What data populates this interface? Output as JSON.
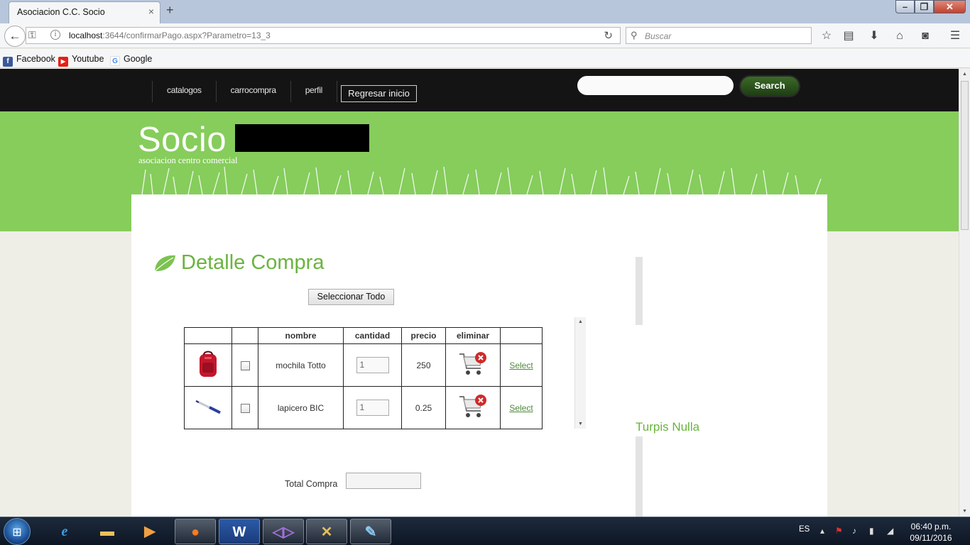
{
  "browser": {
    "tab_title": "Asociacion C.C. Socio",
    "tab_close": "×",
    "new_tab": "+",
    "url_host": "localhost",
    "url_rest": ":3644/confirmarPago.aspx?Parametro=13_3",
    "search_placeholder": "Buscar",
    "bookmarks": [
      "Facebook",
      "Youtube",
      "Google"
    ]
  },
  "site": {
    "menu": [
      "catalogos",
      "carrocompra",
      "perfil"
    ],
    "home_button": "Regresar inicio",
    "search_button": "Search",
    "title": "Socio",
    "subtitle": "asociacion centro comercial"
  },
  "main": {
    "heading": "Detalle Compra",
    "select_all": "Seleccionar Todo",
    "columns": [
      "",
      "",
      "nombre",
      "cantidad",
      "precio",
      "eliminar",
      ""
    ],
    "rows": [
      {
        "nombre": "mochila Totto",
        "cantidad": "1",
        "precio": "250",
        "select": "Select"
      },
      {
        "nombre": "lapicero BIC",
        "cantidad": "1",
        "precio": "0.25",
        "select": "Select"
      }
    ],
    "total_label": "Total Compra",
    "total_value": ""
  },
  "sidebar": {
    "title": "Turpis Nulla"
  },
  "taskbar": {
    "language": "ES",
    "time": "06:40 p.m.",
    "date": "09/11/2016"
  },
  "colors": {
    "accent_green": "#6ab43d",
    "banner_green": "#86cd5c",
    "nav_dark": "#141414"
  }
}
